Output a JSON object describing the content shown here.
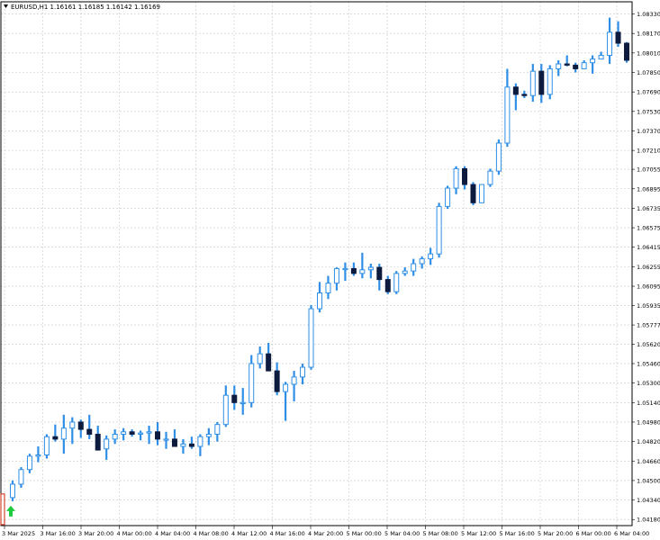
{
  "header": {
    "menu_icon": "triangle-down-icon",
    "text": "EURUSD,H1  1.16161 1.16185 1.16142 1.16169"
  },
  "chart_data": {
    "type": "candlestick",
    "symbol": "EURUSD",
    "timeframe": "H1",
    "ohlc_header": [
      "1.16161",
      "1.16185",
      "1.16142",
      "1.16169"
    ],
    "ylim": [
      1.0413,
      1.0843
    ],
    "y_ticks": [
      "1.08330",
      "1.08170",
      "1.08010",
      "1.07850",
      "1.07690",
      "1.07530",
      "1.07370",
      "1.07210",
      "1.07055",
      "1.06895",
      "1.06735",
      "1.06575",
      "1.06415",
      "1.06255",
      "1.06095",
      "1.05935",
      "1.05777",
      "1.05620",
      "1.05460",
      "1.05300",
      "1.05140",
      "1.04980",
      "1.04820",
      "1.04660",
      "1.04500",
      "1.04340",
      "1.04180"
    ],
    "x_ticks": [
      "3 Mar 2025",
      "3 Mar 16:00",
      "3 Mar 20:00",
      "4 Mar 00:00",
      "4 Mar 04:00",
      "4 Mar 08:00",
      "4 Mar 12:00",
      "4 Mar 16:00",
      "4 Mar 20:00",
      "5 Mar 00:00",
      "5 Mar 04:00",
      "5 Mar 08:00",
      "5 Mar 12:00",
      "5 Mar 16:00",
      "5 Mar 20:00",
      "6 Mar 00:00",
      "6 Mar 04:00"
    ],
    "grid": true,
    "up_color": "#ffffff",
    "down_color": "#0d1b3e",
    "wick_color": "#2f8fe6",
    "signal": {
      "type": "buy-arrow",
      "color": "#1ecb3c",
      "icon": "arrow-up-icon"
    },
    "marker": {
      "color": "#d2452c"
    },
    "candles": [
      [
        1.0436,
        1.045,
        1.0433,
        1.0447
      ],
      [
        1.0447,
        1.0461,
        1.0444,
        1.0459
      ],
      [
        1.0459,
        1.0472,
        1.0456,
        1.047
      ],
      [
        1.047,
        1.0478,
        1.0465,
        1.0471
      ],
      [
        1.0471,
        1.0488,
        1.0468,
        1.0486
      ],
      [
        1.0486,
        1.0496,
        1.0482,
        1.0484
      ],
      [
        1.0484,
        1.0504,
        1.0472,
        1.0493
      ],
      [
        1.0493,
        1.0502,
        1.048,
        1.0498
      ],
      [
        1.0498,
        1.05,
        1.0485,
        1.0492
      ],
      [
        1.0492,
        1.0504,
        1.0484,
        1.0488
      ],
      [
        1.0488,
        1.0495,
        1.0476,
        1.0475
      ],
      [
        1.0476,
        1.0487,
        1.0467,
        1.0484
      ],
      [
        1.0484,
        1.0492,
        1.048,
        1.0488
      ],
      [
        1.0488,
        1.0493,
        1.0483,
        1.049
      ],
      [
        1.049,
        1.0492,
        1.0486,
        1.0488
      ],
      [
        1.0488,
        1.0491,
        1.0483,
        1.0489
      ],
      [
        1.0489,
        1.0495,
        1.048,
        1.049
      ],
      [
        1.049,
        1.0498,
        1.0479,
        1.0484
      ],
      [
        1.0484,
        1.049,
        1.0476,
        1.0484
      ],
      [
        1.0484,
        1.0492,
        1.0478,
        1.0478
      ],
      [
        1.0478,
        1.0484,
        1.0472,
        1.048
      ],
      [
        1.048,
        1.0486,
        1.0476,
        1.0478
      ],
      [
        1.0478,
        1.0488,
        1.047,
        1.0486
      ],
      [
        1.0486,
        1.0493,
        1.0479,
        1.0488
      ],
      [
        1.0488,
        1.0498,
        1.0482,
        1.0496
      ],
      [
        1.0496,
        1.0528,
        1.0494,
        1.052
      ],
      [
        1.052,
        1.0528,
        1.0508,
        1.0514
      ],
      [
        1.0514,
        1.0526,
        1.0504,
        1.0514
      ],
      [
        1.0514,
        1.0553,
        1.051,
        1.0546
      ],
      [
        1.0546,
        1.056,
        1.0542,
        1.0554
      ],
      [
        1.0554,
        1.0563,
        1.0541,
        1.054
      ],
      [
        1.054,
        1.0547,
        1.052,
        1.0523
      ],
      [
        1.0523,
        1.0531,
        1.0499,
        1.0529
      ],
      [
        1.0529,
        1.054,
        1.0515,
        1.0535
      ],
      [
        1.0535,
        1.0546,
        1.0529,
        1.0543
      ],
      [
        1.0543,
        1.0594,
        1.0541,
        1.0591
      ],
      [
        1.0591,
        1.0613,
        1.0588,
        1.0604
      ],
      [
        1.0604,
        1.0618,
        1.0599,
        1.0612
      ],
      [
        1.0612,
        1.0625,
        1.0606,
        1.0624
      ],
      [
        1.0624,
        1.0629,
        1.0614,
        1.0624
      ],
      [
        1.0624,
        1.0629,
        1.0618,
        1.062
      ],
      [
        1.062,
        1.0637,
        1.0616,
        1.0623
      ],
      [
        1.0623,
        1.0628,
        1.0616,
        1.0625
      ],
      [
        1.0625,
        1.0628,
        1.0606,
        1.0615
      ],
      [
        1.0615,
        1.0618,
        1.0603,
        1.0605
      ],
      [
        1.0605,
        1.0622,
        1.0603,
        1.062
      ],
      [
        1.062,
        1.0625,
        1.0618,
        1.0622
      ],
      [
        1.0622,
        1.0632,
        1.0618,
        1.0628
      ],
      [
        1.0628,
        1.0634,
        1.0624,
        1.0632
      ],
      [
        1.0632,
        1.0641,
        1.0627,
        1.0636
      ],
      [
        1.0636,
        1.0678,
        1.0633,
        1.0675
      ],
      [
        1.0675,
        1.0692,
        1.0673,
        1.069
      ],
      [
        1.069,
        1.0708,
        1.0685,
        1.0706
      ],
      [
        1.0706,
        1.0708,
        1.0689,
        1.0693
      ],
      [
        1.0693,
        1.0695,
        1.0676,
        1.0678
      ],
      [
        1.0678,
        1.0686,
        1.0678,
        1.0693
      ],
      [
        1.0693,
        1.0706,
        1.0691,
        1.0704
      ],
      [
        1.0704,
        1.073,
        1.0701,
        1.0727
      ],
      [
        1.0727,
        1.0788,
        1.0724,
        1.0773
      ],
      [
        1.0773,
        1.0776,
        1.0754,
        1.0767
      ],
      [
        1.0767,
        1.077,
        1.0764,
        1.0766
      ],
      [
        1.0766,
        1.0792,
        1.0761,
        1.0786
      ],
      [
        1.0786,
        1.0792,
        1.076,
        1.0767
      ],
      [
        1.0767,
        1.0791,
        1.0763,
        1.0788
      ],
      [
        1.0788,
        1.0795,
        1.0782,
        1.0792
      ],
      [
        1.0792,
        1.0799,
        1.079,
        1.0791
      ],
      [
        1.0791,
        1.0793,
        1.0785,
        1.0788
      ],
      [
        1.0788,
        1.0795,
        1.0788,
        1.0793
      ],
      [
        1.0793,
        1.0799,
        1.0784,
        1.0796
      ],
      [
        1.0796,
        1.0802,
        1.0796,
        1.0799
      ],
      [
        1.0799,
        1.083,
        1.0792,
        1.0818
      ],
      [
        1.0818,
        1.0827,
        1.0806,
        1.0809
      ],
      [
        1.0809,
        1.081,
        1.0793,
        1.0795
      ]
    ]
  }
}
